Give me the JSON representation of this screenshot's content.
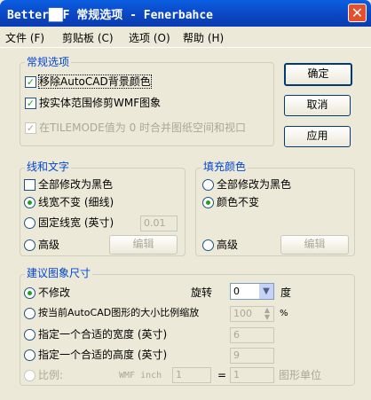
{
  "window": {
    "title": "Better██F 常规选项 - Fenerbahce",
    "close_glyph": "✕"
  },
  "menu": [
    "文件 (F)",
    "剪贴板 (C)",
    "选项 (O)",
    "帮助 (H)"
  ],
  "general": {
    "legend": "常规选项",
    "remove_bg": "移除AutoCAD背景颜色",
    "clip_wmf": "按实体范围修剪WMF图象",
    "merge_tilemode": "在TILEMODE值为 0 时合并图纸空间和视口"
  },
  "buttons": {
    "ok": "确定",
    "cancel": "取消",
    "apply": "应用"
  },
  "lines": {
    "legend": "线和文字",
    "all_black": "全部修改为黑色",
    "width_unchanged": "线宽不变 (细线)",
    "fixed_width": "固定线宽 (英寸)",
    "fixed_value": "0.01",
    "advanced": "高级",
    "edit": "编辑"
  },
  "fill": {
    "legend": "填充颜色",
    "all_black": "全部修改为黑色",
    "color_unchanged": "颜色不变",
    "advanced": "高级",
    "edit": "编辑"
  },
  "size": {
    "legend": "建议图象尺寸",
    "no_change": "不修改",
    "rotate_label": "旋转",
    "rotate_value": "0",
    "degree": "度",
    "scale_by_acad": "按当前AutoCAD图形的大小比例缩放",
    "scale_value": "100",
    "percent": "%",
    "fit_width": "指定一个合适的宽度 (英寸)",
    "width_value": "6",
    "fit_height": "指定一个合适的高度 (英寸)",
    "height_value": "9",
    "ratio": "比例:",
    "wmf_inch": "WMF inch",
    "ratio_left": "1",
    "equals": "=",
    "ratio_right": "1",
    "drawing_units": "图形单位"
  }
}
